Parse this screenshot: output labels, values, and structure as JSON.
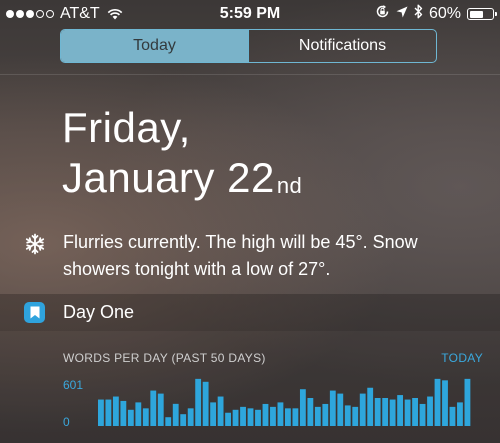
{
  "status_bar": {
    "carrier": "AT&T",
    "time": "5:59 PM",
    "battery_percent": "60%",
    "battery_level": 0.6,
    "signal_bars_filled": 3,
    "signal_bars_total": 5,
    "icons": [
      "wifi-icon",
      "rotation-lock-icon",
      "location-arrow-icon",
      "bluetooth-icon",
      "battery-icon"
    ]
  },
  "tabs": {
    "today": "Today",
    "notifications": "Notifications",
    "selected": "today"
  },
  "date": {
    "line1": "Friday,",
    "line2_main": "January 22",
    "line2_suffix": "nd"
  },
  "weather": {
    "icon": "snowflake-icon",
    "text": "Flurries currently. The high will be 45°. Snow showers tonight with a low of 27°."
  },
  "widget": {
    "icon": "day-one-bookmark-icon",
    "title": "Day One",
    "chart_label": "WORDS PER DAY (PAST 50 DAYS)",
    "today_link": "TODAY",
    "y_max_label": "601",
    "y_min_label": "0"
  },
  "colors": {
    "accent": "#3aa8dd",
    "bar": "#2ea6dc",
    "segment_active": "#7ab3c9",
    "segment_border": "#6fb7d3"
  },
  "chart_data": {
    "type": "bar",
    "title": "WORDS PER DAY (PAST 50 DAYS)",
    "ylim": [
      0,
      601
    ],
    "y_tick_labels": [
      "601",
      "0"
    ],
    "values": [
      289,
      289,
      322,
      274,
      177,
      258,
      193,
      387,
      354,
      96,
      242,
      129,
      193,
      515,
      483,
      258,
      322,
      145,
      177,
      209,
      193,
      177,
      241,
      209,
      258,
      193,
      193,
      402,
      306,
      209,
      241,
      387,
      354,
      225,
      209,
      354,
      418,
      306,
      306,
      289,
      338,
      289,
      306,
      241,
      322,
      515,
      499,
      209,
      258,
      515
    ]
  }
}
